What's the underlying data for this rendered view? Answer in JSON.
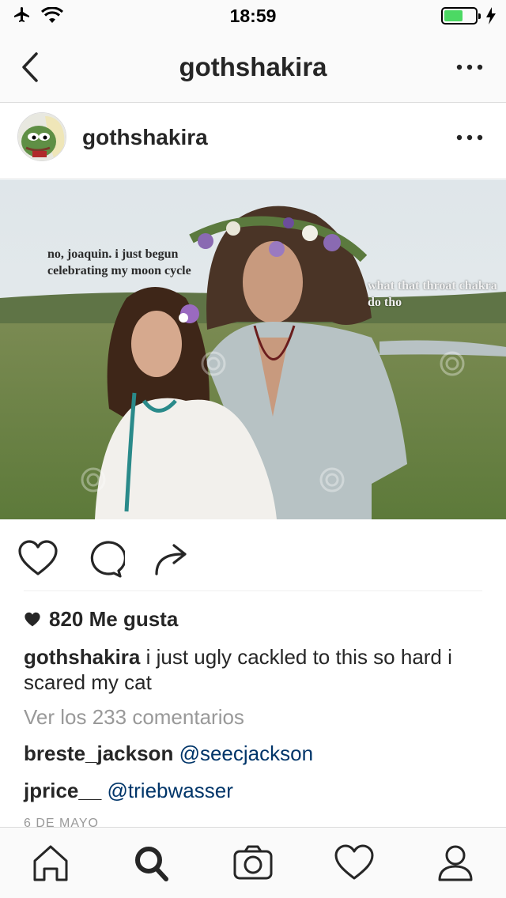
{
  "status_bar": {
    "time": "18:59",
    "battery_level": 0.6,
    "battery_color": "#4cd964"
  },
  "nav": {
    "title": "gothshakira",
    "back_icon": "chevron-left-icon",
    "more_icon": "more-horizontal-icon"
  },
  "post": {
    "username": "gothshakira",
    "photo": {
      "text_left": "no, joaquin. i just begun celebrating my moon cycle",
      "text_right": "what that throat chakra do tho"
    },
    "actions": [
      "heart-icon",
      "comment-icon",
      "share-icon"
    ],
    "likes": "820 Me gusta",
    "caption_user": "gothshakira",
    "caption_text": " i just ugly cackled to this so hard i scared my cat",
    "view_comments": "Ver los 233 comentarios",
    "comments": [
      {
        "user": "breste_jackson",
        "mention": "@seecjackson"
      },
      {
        "user": "jprice__",
        "mention": "@triebwasser"
      }
    ],
    "date": "6 DE MAYO"
  },
  "tabbar": [
    "home-icon",
    "search-icon",
    "camera-icon",
    "activity-heart-icon",
    "profile-icon"
  ],
  "colors": {
    "mention": "#003569",
    "muted": "#999999",
    "text": "#262626"
  }
}
